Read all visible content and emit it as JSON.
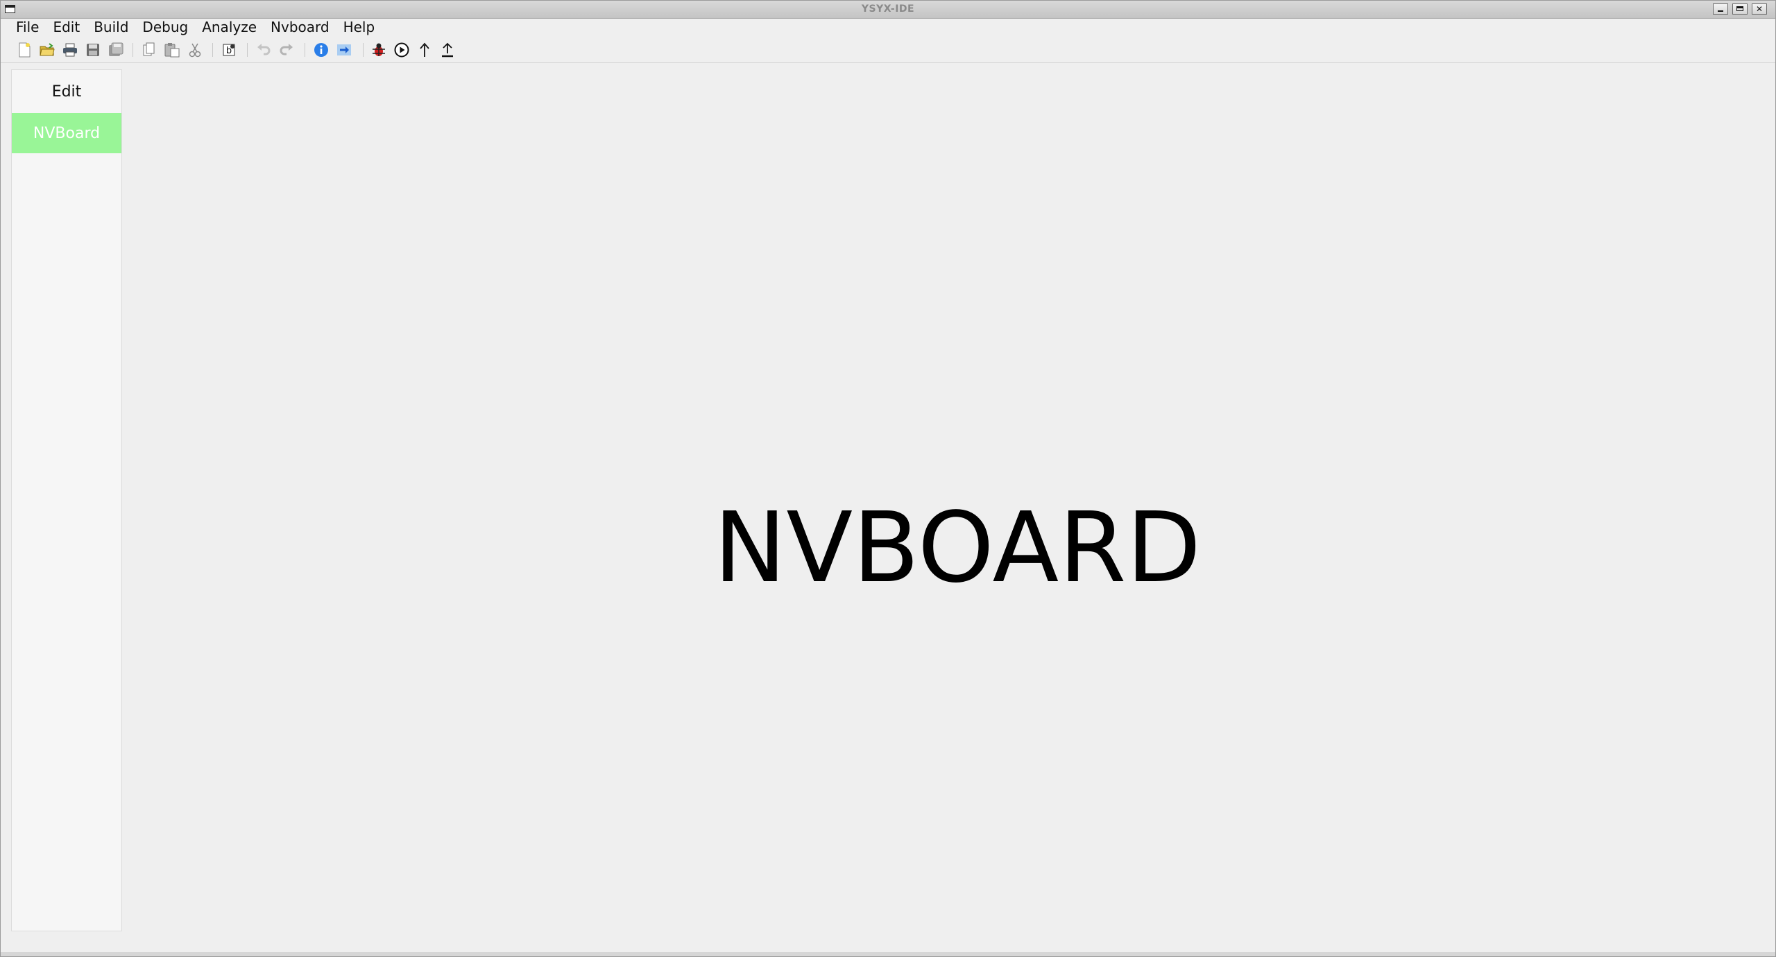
{
  "window": {
    "title": "YSYX-IDE"
  },
  "menubar": {
    "items": [
      "File",
      "Edit",
      "Build",
      "Debug",
      "Analyze",
      "Nvboard",
      "Help"
    ]
  },
  "toolbar": {
    "buttons": [
      {
        "icon": "new-file-icon",
        "enabled": true
      },
      {
        "icon": "open-folder-icon",
        "enabled": true
      },
      {
        "icon": "print-icon",
        "enabled": true
      },
      {
        "icon": "save-icon",
        "enabled": true
      },
      {
        "icon": "save-all-icon",
        "enabled": true
      },
      {
        "icon": "copy-icon",
        "enabled": true
      },
      {
        "icon": "paste-icon",
        "enabled": true
      },
      {
        "icon": "cut-icon",
        "enabled": true
      },
      {
        "icon": "build-icon",
        "enabled": true
      },
      {
        "icon": "undo-icon",
        "enabled": false
      },
      {
        "icon": "redo-icon",
        "enabled": false
      },
      {
        "icon": "info-icon",
        "enabled": true
      },
      {
        "icon": "forward-arrow-icon",
        "enabled": true
      },
      {
        "icon": "debug-bug-icon",
        "enabled": true
      },
      {
        "icon": "run-icon",
        "enabled": true
      },
      {
        "icon": "step-up-icon",
        "enabled": true
      },
      {
        "icon": "upload-icon",
        "enabled": true
      }
    ]
  },
  "sidebar": {
    "items": [
      {
        "label": "Edit",
        "selected": false
      },
      {
        "label": "NVBoard",
        "selected": true
      }
    ]
  },
  "main": {
    "heading": "NVBOARD"
  },
  "colors": {
    "selected_sidebar_bg": "#99f597",
    "window_bg": "#efefef"
  }
}
